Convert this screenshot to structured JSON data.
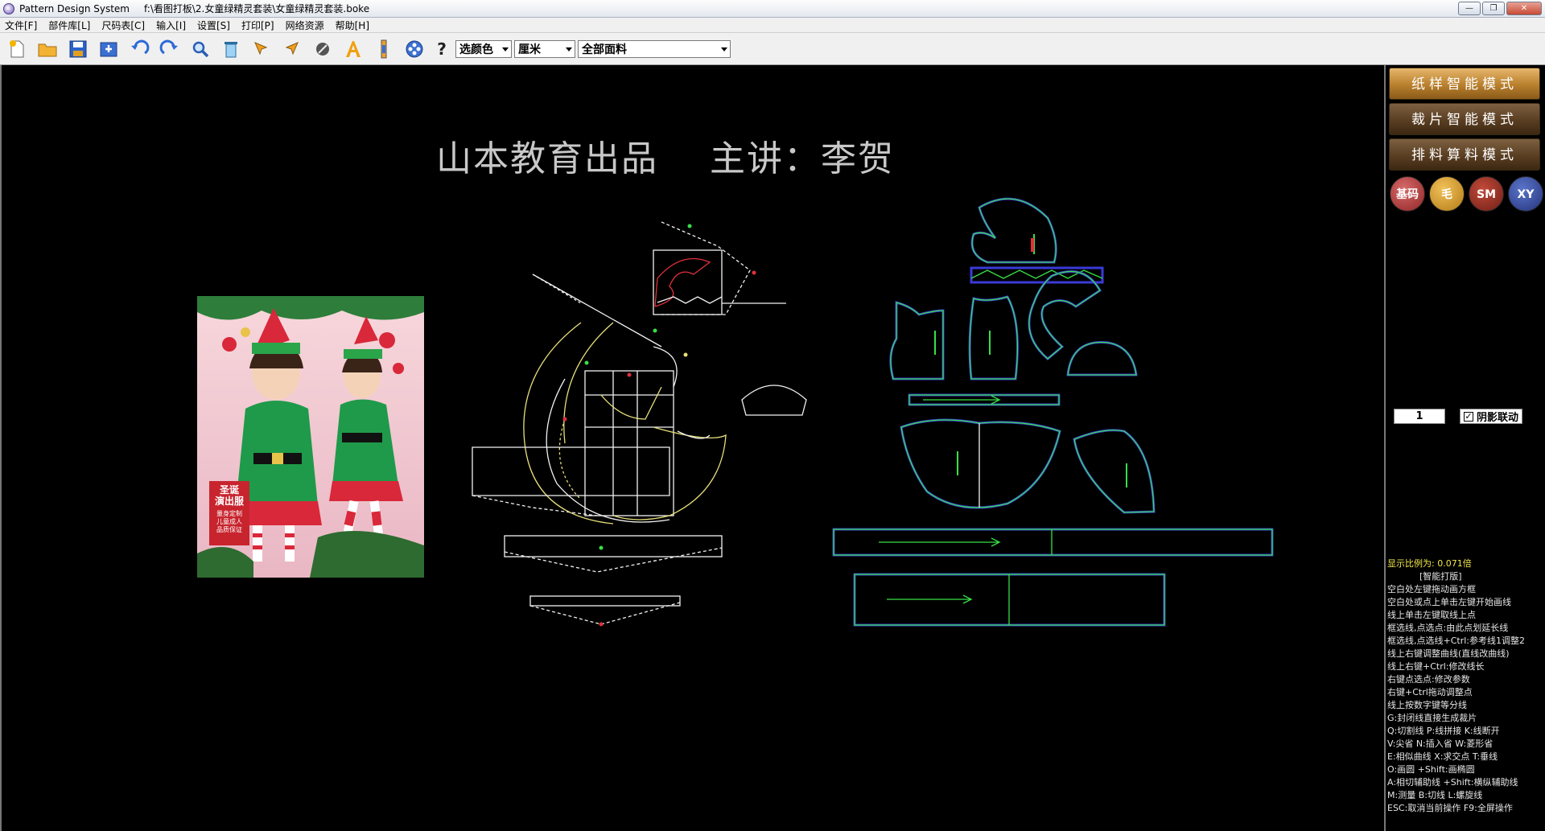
{
  "window": {
    "app_name": "Pattern Design System",
    "file_path": "f:\\看图打板\\2.女童绿精灵套装\\女童绿精灵套装.boke",
    "minimize": "—",
    "maximize": "❐",
    "close": "✕"
  },
  "menu": [
    "文件[F]",
    "部件库[L]",
    "尺码表[C]",
    "输入[I]",
    "设置[S]",
    "打印[P]",
    "网络资源",
    "帮助[H]"
  ],
  "toolbar": {
    "help": "?",
    "color_select": "选颜色",
    "unit_select": "厘米",
    "fabric_select": "全部面料"
  },
  "canvas": {
    "title": "山本教育出品    主讲：李贺",
    "photo_badge_title": "圣诞\n演出服",
    "photo_badge_sub": "量身定制\n儿童成人\n品质保证"
  },
  "sidebar": {
    "mode_paper": "纸样智能模式",
    "mode_cut": "裁片智能模式",
    "mode_layout": "排料算料模式",
    "btn_base": "基码",
    "btn_mao": "毛",
    "btn_sm": "SM",
    "btn_xy": "XY",
    "number_value": "1",
    "shadow_link": "阴影联动",
    "check_mark": "✓",
    "scale_text": "显示比例为: 0.071倍",
    "mode_label": "[智能打版]",
    "hints": [
      "空白处左键拖动画方框",
      "空白处或点上单击左键开始画线",
      "线上单击左键取线上点",
      "框选线,点选点:由此点划延长线",
      "框选线,点选线+Ctrl:参考线1调整2",
      "线上右键调整曲线(直线改曲线)",
      "线上右键+Ctrl:修改线长",
      "右键点选点:修改参数",
      "右键+Ctrl拖动调整点",
      "线上按数字键等分线",
      "G:封闭线直接生成裁片",
      "Q:切割线  P:线拼接  K:线断开",
      "V:尖省  N:插入省  W:菱形省",
      "E:相似曲线  X:求交点  T:垂线",
      "O:画圆 +Shift:画椭圆",
      "A:相切辅助线 +Shift:横纵辅助线",
      "M:测量  B:切线  L:螺旋线",
      "ESC:取消当前操作  F9:全屏操作"
    ]
  },
  "colors": {
    "pattern_line": "#36e046",
    "pattern_outline": "#3a3ad8",
    "draft_line": "#f2f2f2",
    "curve_line": "#e8e07a",
    "accent_red": "#e0303a"
  }
}
